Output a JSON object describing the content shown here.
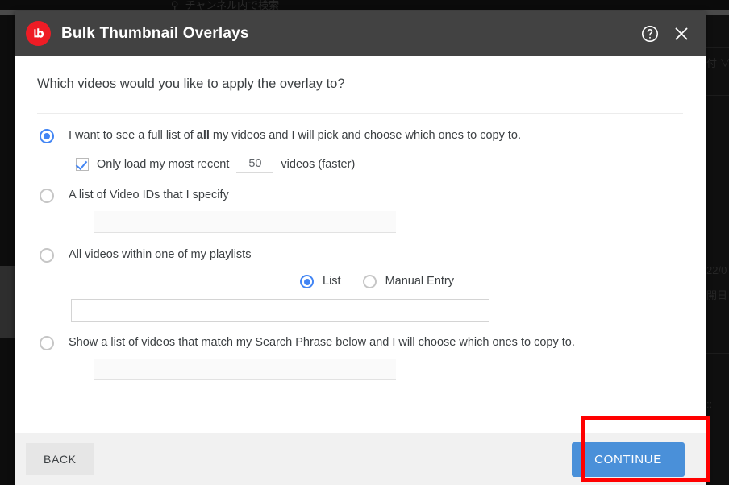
{
  "backdrop": {
    "search_icon": "search-icon",
    "search_placeholder_text": "チャンネル内で検索",
    "right_column_lines": [
      "付 ∨",
      "22/0",
      "開日",
      "::"
    ]
  },
  "modal": {
    "logo_icon": "tubebuddy-logo-icon",
    "title": "Bulk Thumbnail Overlays",
    "help_icon": "help-circle-icon",
    "close_icon": "close-icon",
    "question": "Which videos would you like to apply the overlay to?",
    "options": [
      {
        "id": "all-videos",
        "label_before_bold": "I want to see a full list of ",
        "label_bold": "all",
        "label_after_bold": " my videos and I will pick and choose which ones to copy to.",
        "selected": true,
        "sub": {
          "checkbox_checked": true,
          "checkbox_label": "Only load my most recent",
          "count_value": "50",
          "count_placeholder": "",
          "trailing_label": "videos (faster)"
        }
      },
      {
        "id": "video-ids",
        "label": "A list of Video IDs that I specify",
        "selected": false,
        "field_value": "",
        "field_placeholder": ""
      },
      {
        "id": "playlist",
        "label": "All videos within one of my playlists",
        "selected": false,
        "mode_options": [
          {
            "label": "List",
            "selected": true
          },
          {
            "label": "Manual Entry",
            "selected": false
          }
        ],
        "select_value": "",
        "select_placeholder": ""
      },
      {
        "id": "search-phrase",
        "label": "Show a list of videos that match my Search Phrase below and I will choose which ones to copy to.",
        "selected": false,
        "field_value": "",
        "field_placeholder": ""
      }
    ],
    "footer": {
      "back_label": "BACK",
      "continue_label": "CONTINUE"
    }
  },
  "annotation": {
    "target": "continue-button",
    "color": "#ff0000"
  },
  "colors": {
    "header_bg": "#424242",
    "logo_red": "#ee1c25",
    "accent_blue": "#4285f4",
    "continue_blue": "#4a90d9",
    "footer_bg": "#f1f1f1",
    "text": "#3c4043"
  }
}
